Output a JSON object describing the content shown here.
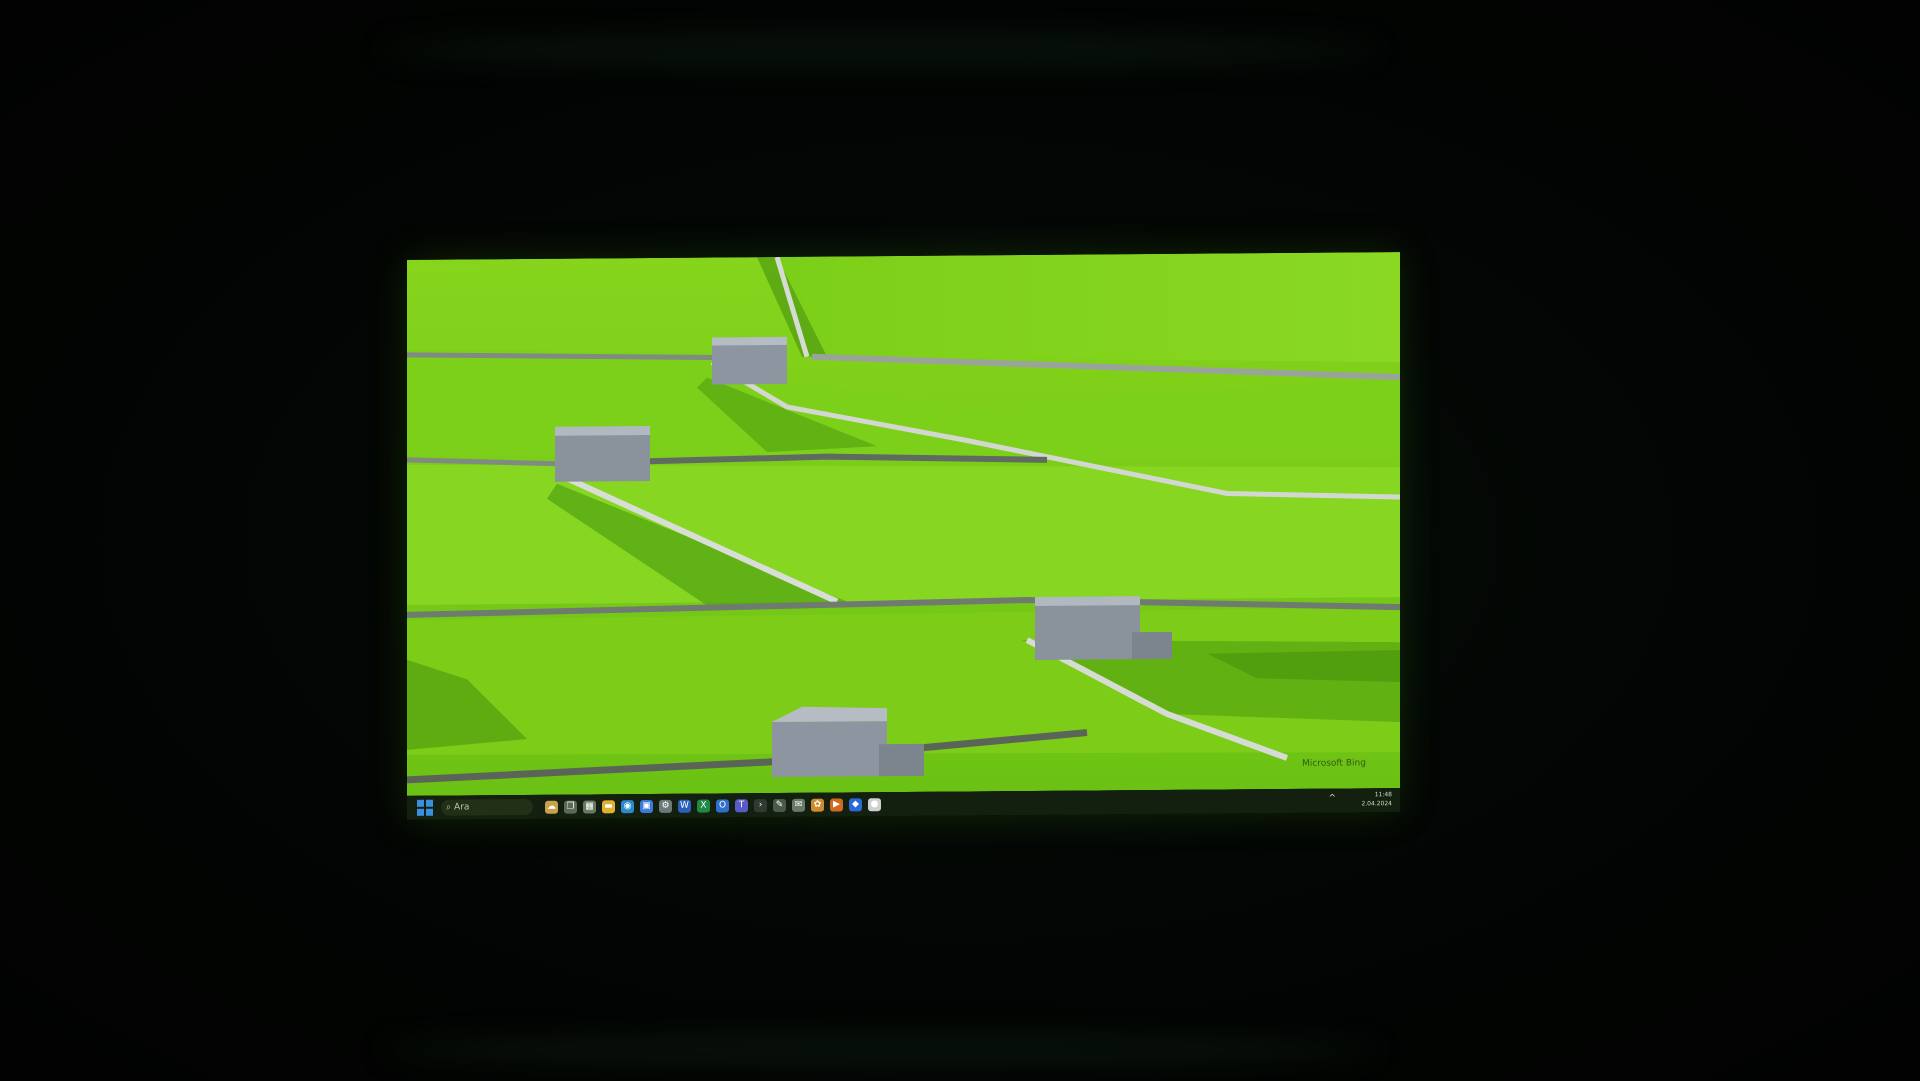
{
  "desktop": {
    "wallpaper": {
      "description_icon": "landscape-wallpaper",
      "colors": {
        "grass": "#7fd41a",
        "grass_dark": "#4fa010",
        "wall": "#c9d0c8",
        "barn": "#8f96a0"
      }
    },
    "copyright": "Microsoft Bing"
  },
  "taskbar": {
    "search_placeholder": "Ara",
    "icons": [
      {
        "name": "weather-icon",
        "glyph": "☁",
        "color": "#c8a24a"
      },
      {
        "name": "task-view-icon",
        "glyph": "❐",
        "color": "#5a6a55"
      },
      {
        "name": "widgets-icon",
        "glyph": "▦",
        "color": "#6a7a60"
      },
      {
        "name": "file-explorer-icon",
        "glyph": "▬",
        "color": "#e0b030"
      },
      {
        "name": "edge-icon",
        "glyph": "◉",
        "color": "#2a8ad0"
      },
      {
        "name": "store-icon",
        "glyph": "▣",
        "color": "#3a7ad8"
      },
      {
        "name": "settings-icon",
        "glyph": "⚙",
        "color": "#6a7a7a"
      },
      {
        "name": "word-icon",
        "glyph": "W",
        "color": "#2b5fb8"
      },
      {
        "name": "excel-icon",
        "glyph": "X",
        "color": "#1f8a44"
      },
      {
        "name": "outlook-icon",
        "glyph": "O",
        "color": "#2f6fd0"
      },
      {
        "name": "teams-icon",
        "glyph": "T",
        "color": "#5a5ac8"
      },
      {
        "name": "terminal-icon",
        "glyph": "›",
        "color": "#303a30"
      },
      {
        "name": "pen-icon",
        "glyph": "✎",
        "color": "#4a5a4a"
      },
      {
        "name": "chat-icon",
        "glyph": "✉",
        "color": "#6a7a6a"
      },
      {
        "name": "photos-icon",
        "glyph": "✿",
        "color": "#d08a30"
      },
      {
        "name": "media-icon",
        "glyph": "▶",
        "color": "#d06a20"
      },
      {
        "name": "security-icon",
        "glyph": "◆",
        "color": "#2a6ad8"
      },
      {
        "name": "chrome-icon",
        "glyph": "●",
        "color": "#d0d0d0"
      }
    ]
  },
  "tray": {
    "chevron": "^",
    "time": "11:48",
    "date": "2.04.2024"
  }
}
